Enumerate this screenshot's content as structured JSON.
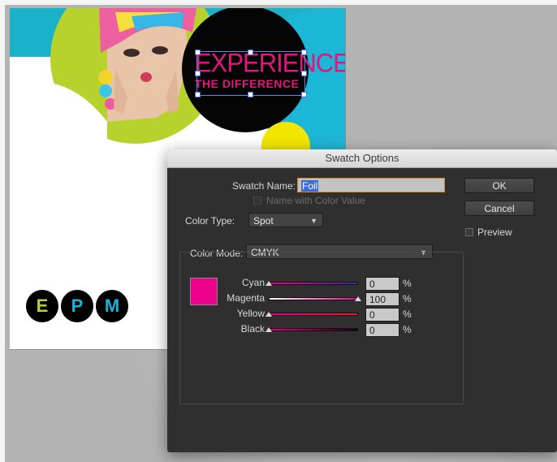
{
  "document": {
    "headline_line1": "EXPERIENCE",
    "headline_line2": "THE DIFFERENCE",
    "logo_letters": [
      "E",
      "P",
      "M"
    ]
  },
  "dialog": {
    "title": "Swatch Options",
    "swatch_name_label": "Swatch Name:",
    "swatch_name_value": "Foil",
    "name_with_color_value_label": "Name with Color Value",
    "color_type_label": "Color Type:",
    "color_type_value": "Spot",
    "color_mode_label": "Color Mode:",
    "color_mode_value": "CMYK",
    "ok_label": "OK",
    "cancel_label": "Cancel",
    "preview_label": "Preview",
    "swatch_color": "#ec008c",
    "sliders": [
      {
        "name": "Cyan",
        "value": "0",
        "unit": "%",
        "fraction": 0
      },
      {
        "name": "Magenta",
        "value": "100",
        "unit": "%",
        "fraction": 1
      },
      {
        "name": "Yellow",
        "value": "0",
        "unit": "%",
        "fraction": 0
      },
      {
        "name": "Black",
        "value": "0",
        "unit": "%",
        "fraction": 0
      }
    ]
  }
}
